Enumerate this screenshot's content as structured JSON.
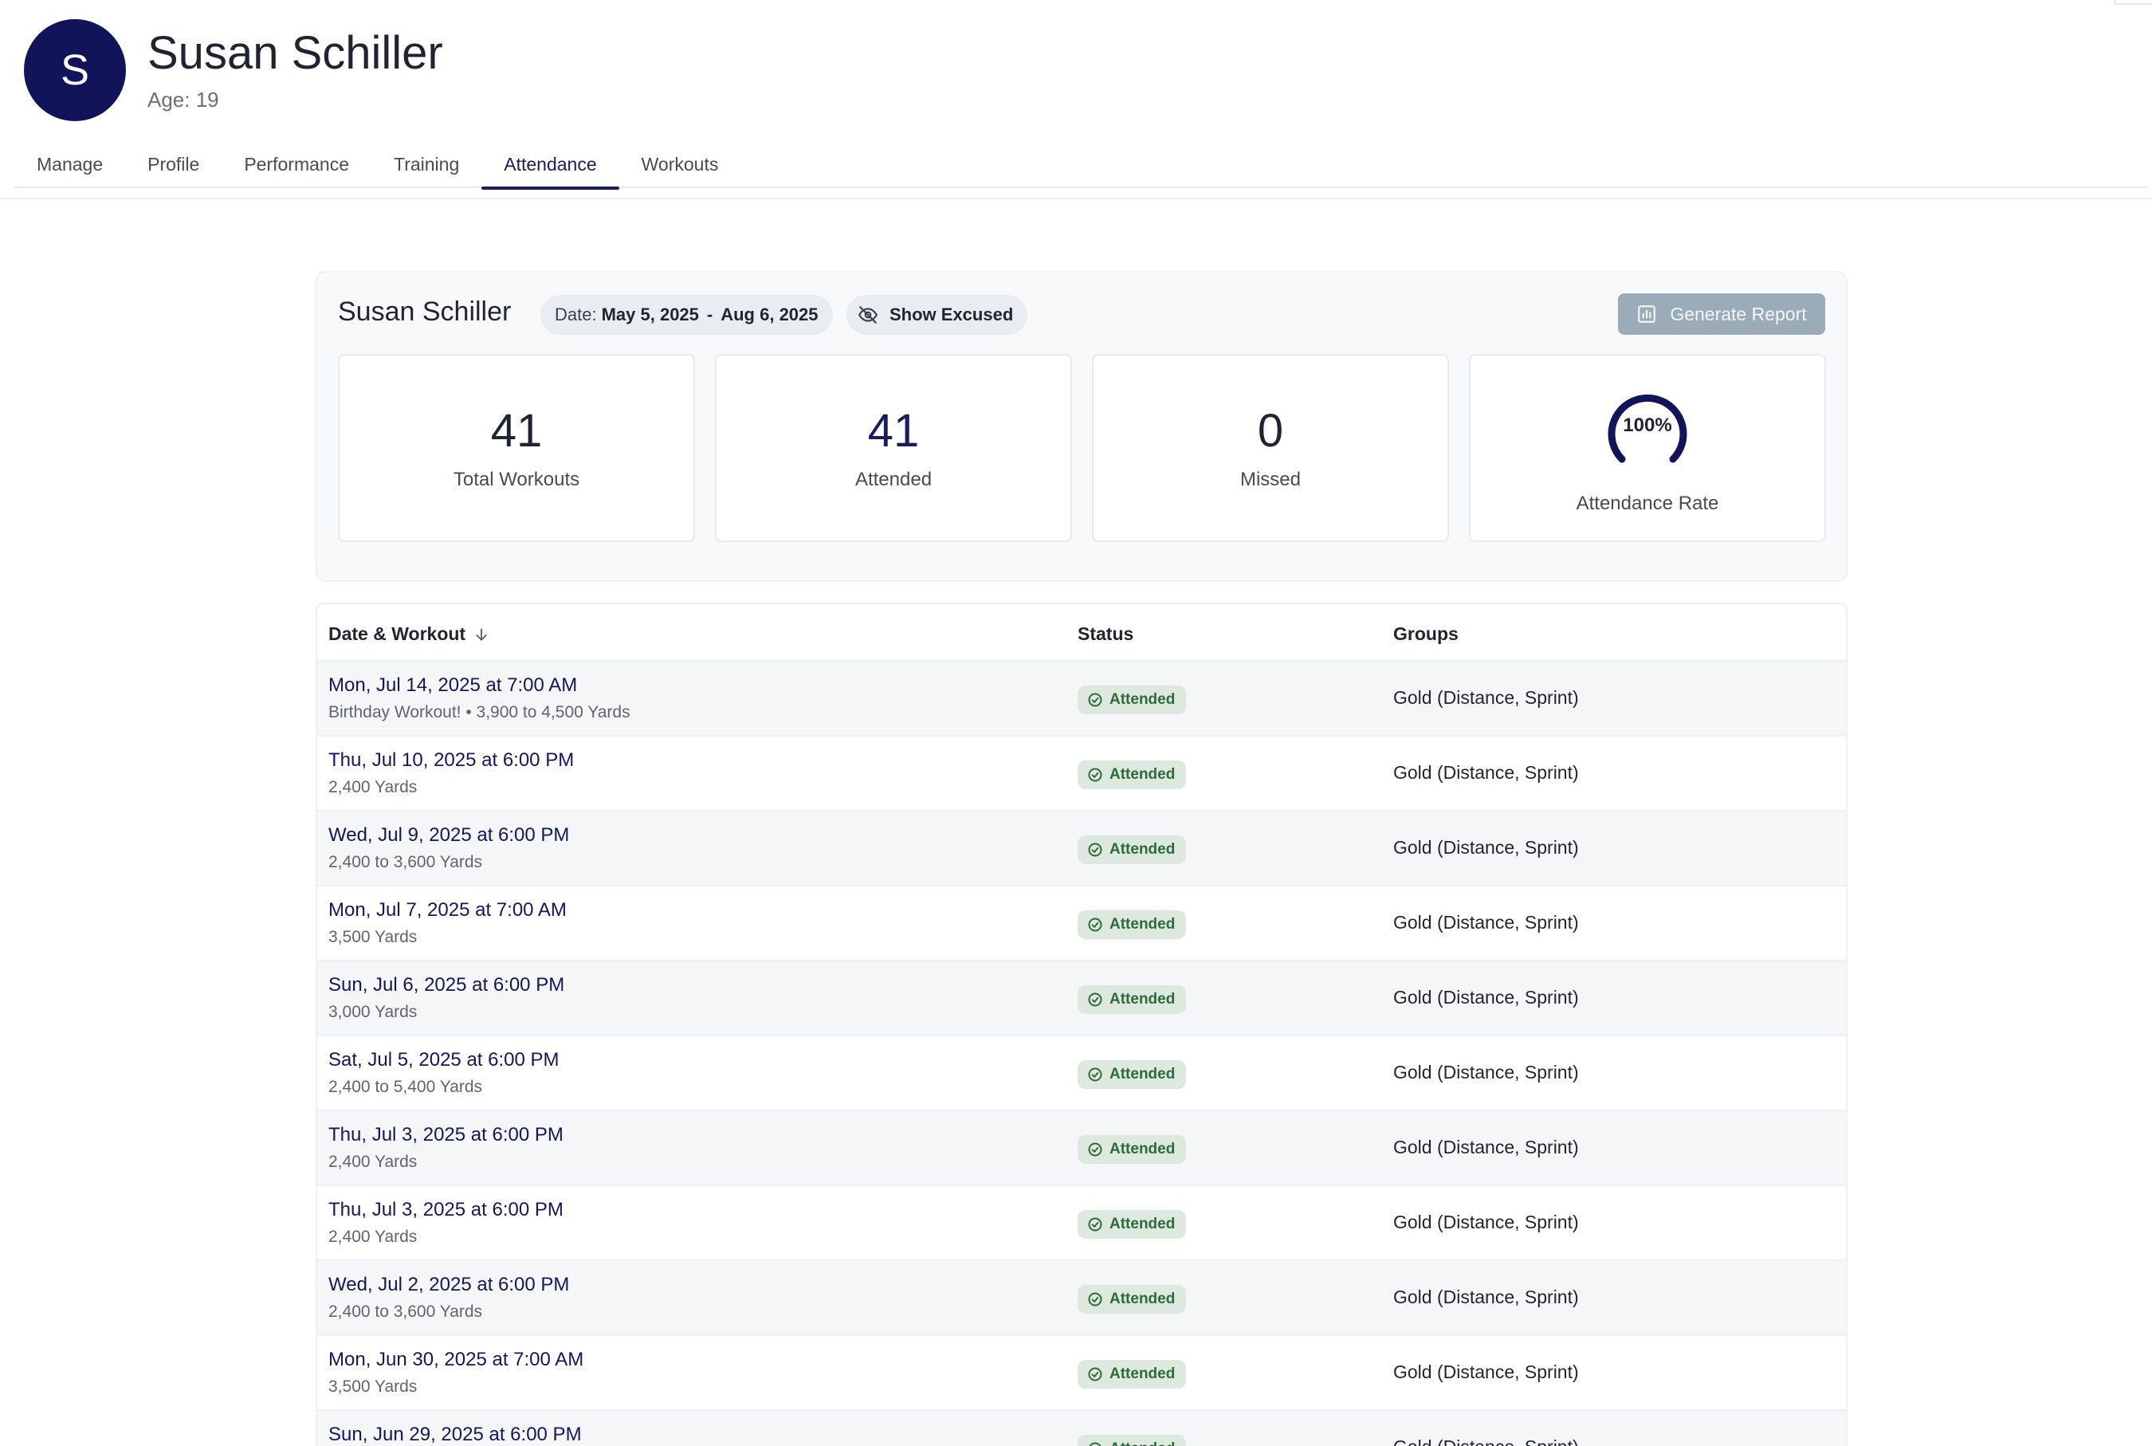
{
  "header": {
    "avatar_initial": "S",
    "name": "Susan Schiller",
    "age": "Age: 19"
  },
  "tabs": [
    {
      "label": "Manage"
    },
    {
      "label": "Profile"
    },
    {
      "label": "Performance"
    },
    {
      "label": "Training"
    },
    {
      "label": "Attendance",
      "active": true
    },
    {
      "label": "Workouts"
    }
  ],
  "summary": {
    "title": "Susan Schiller",
    "date_label": "Date:",
    "date_start": "May 5, 2025",
    "date_separator": "-",
    "date_end": "Aug 6, 2025",
    "show_excused": "Show Excused",
    "generate_report": "Generate Report",
    "stats": {
      "total_value": "41",
      "total_label": "Total Workouts",
      "attended_value": "41",
      "attended_label": "Attended",
      "missed_value": "0",
      "missed_label": "Missed",
      "rate_value": "100%",
      "rate_fraction": 1.0,
      "rate_label": "Attendance Rate"
    }
  },
  "table": {
    "headers": {
      "date": "Date & Workout",
      "status": "Status",
      "groups": "Groups"
    },
    "rows": [
      {
        "date": "Mon, Jul 14, 2025 at 7:00 AM",
        "sub": "Birthday Workout! • 3,900 to 4,500 Yards",
        "status": "Attended",
        "groups": "Gold (Distance, Sprint)"
      },
      {
        "date": "Thu, Jul 10, 2025 at 6:00 PM",
        "sub": "2,400 Yards",
        "status": "Attended",
        "groups": "Gold (Distance, Sprint)"
      },
      {
        "date": "Wed, Jul 9, 2025 at 6:00 PM",
        "sub": "2,400 to 3,600 Yards",
        "status": "Attended",
        "groups": "Gold (Distance, Sprint)"
      },
      {
        "date": "Mon, Jul 7, 2025 at 7:00 AM",
        "sub": "3,500 Yards",
        "status": "Attended",
        "groups": "Gold (Distance, Sprint)"
      },
      {
        "date": "Sun, Jul 6, 2025 at 6:00 PM",
        "sub": "3,000 Yards",
        "status": "Attended",
        "groups": "Gold (Distance, Sprint)"
      },
      {
        "date": "Sat, Jul 5, 2025 at 6:00 PM",
        "sub": "2,400 to 5,400 Yards",
        "status": "Attended",
        "groups": "Gold (Distance, Sprint)"
      },
      {
        "date": "Thu, Jul 3, 2025 at 6:00 PM",
        "sub": "2,400 Yards",
        "status": "Attended",
        "groups": "Gold (Distance, Sprint)"
      },
      {
        "date": "Thu, Jul 3, 2025 at 6:00 PM",
        "sub": "2,400 Yards",
        "status": "Attended",
        "groups": "Gold (Distance, Sprint)"
      },
      {
        "date": "Wed, Jul 2, 2025 at 6:00 PM",
        "sub": "2,400 to 3,600 Yards",
        "status": "Attended",
        "groups": "Gold (Distance, Sprint)"
      },
      {
        "date": "Mon, Jun 30, 2025 at 7:00 AM",
        "sub": "3,500 Yards",
        "status": "Attended",
        "groups": "Gold (Distance, Sprint)"
      },
      {
        "date": "Sun, Jun 29, 2025 at 6:00 PM",
        "sub": "",
        "status": "Attended",
        "groups": "Gold (Distance, Sprint)"
      }
    ]
  },
  "colors": {
    "brand_navy": "#12145a",
    "attended_badge_bg": "#dde9df",
    "attended_badge_text": "#2d6b3a",
    "report_button": "#9aacb8"
  },
  "icons": {
    "show_excused": "eye-off-icon",
    "generate_report": "chart-report-icon",
    "sort": "arrow-down-icon",
    "status": "check-circle-icon"
  }
}
